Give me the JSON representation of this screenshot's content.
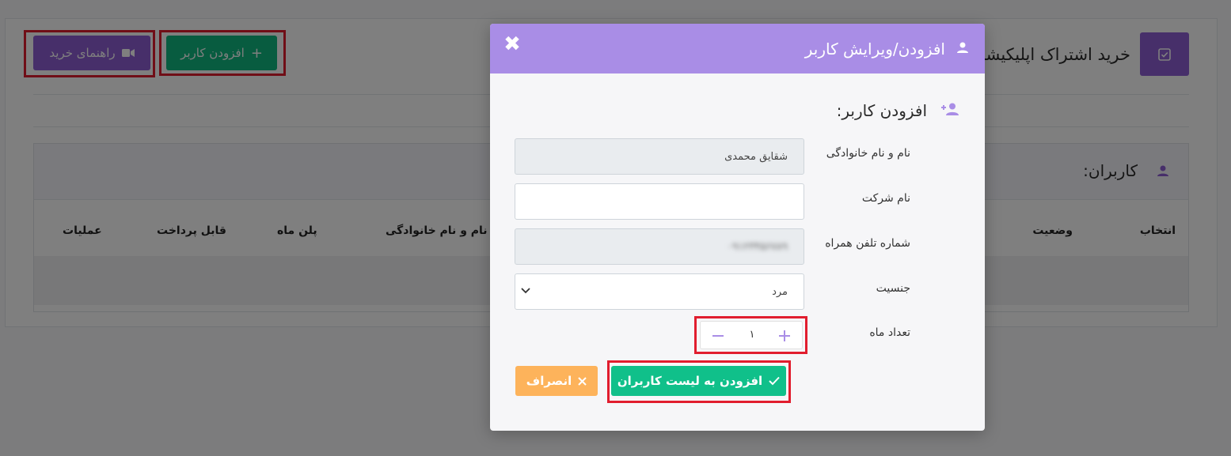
{
  "page": {
    "title": "خرید اشتراک اپلیکیشن",
    "guide_button": "راهنمای خرید",
    "add_user_button": "افزودن کاربر",
    "users_title": "کاربران:",
    "table_headers": [
      "انتخاب",
      "وضعیت",
      "نام و نام خانوادگی",
      "پلن ماه",
      "قابل پرداخت",
      "عملیات"
    ]
  },
  "modal": {
    "title": "افزودن/ویرایش کاربر",
    "close_glyph": "✖",
    "section_title": "افزودن کاربر:",
    "fields": {
      "full_name_label": "نام و نام خانوادگی",
      "full_name_value": "شقایق محمدی",
      "company_label": "نام شرکت",
      "company_value": "",
      "phone_label": "شماره تلفن همراه",
      "phone_value": "۰۹۱۲۳۴۵۶۷۸۹",
      "gender_label": "جنسیت",
      "gender_value": "مرد",
      "months_label": "تعداد ماه",
      "months_value": "۱"
    },
    "submit_button": "افزودن به لیست کاربران",
    "cancel_button": "انصراف"
  },
  "colors": {
    "purple": "#8e5fd4",
    "modal_header": "#a98de6",
    "green": "#10b981",
    "orange": "#fdb35b",
    "highlight_red": "#e11d2e"
  }
}
